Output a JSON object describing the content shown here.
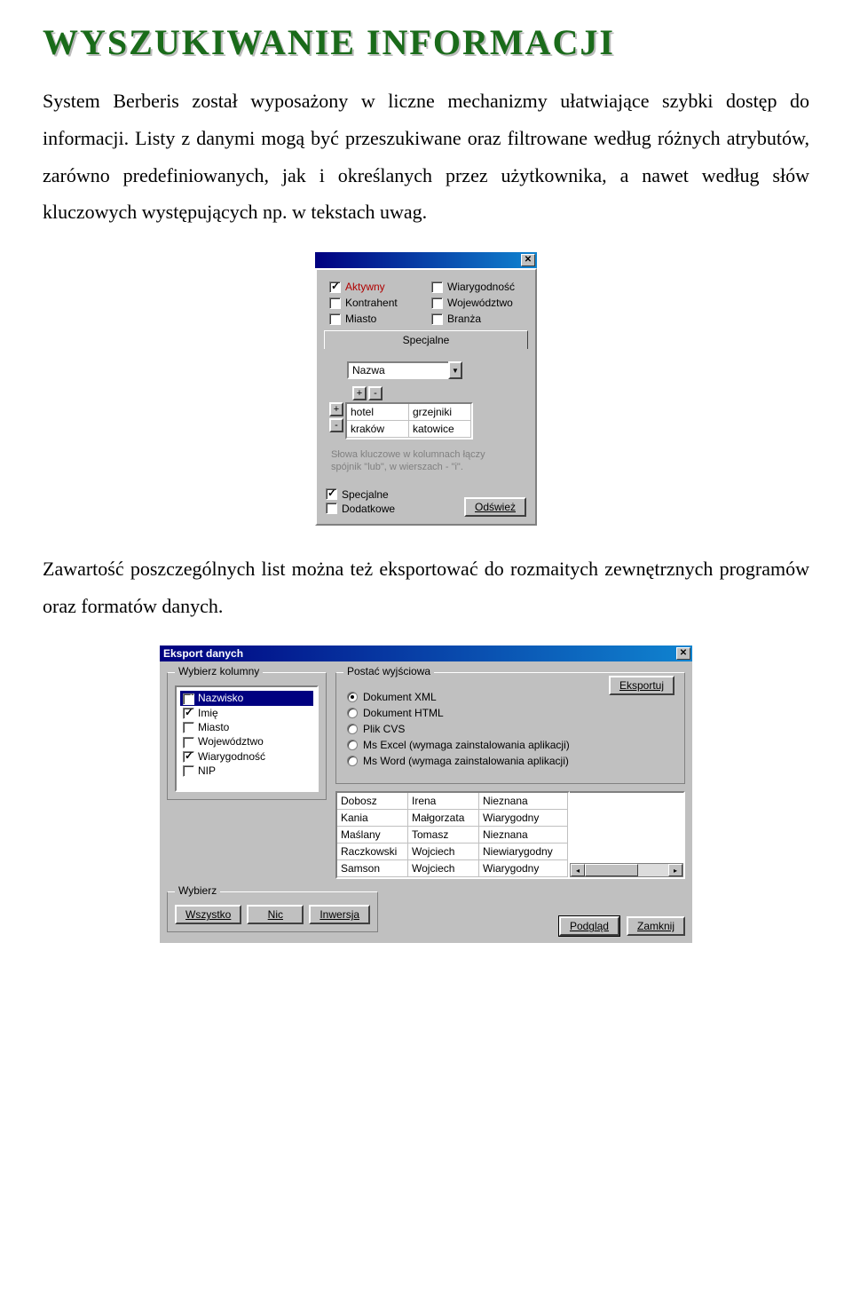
{
  "title": "WYSZUKIWANIE INFORMACJI",
  "para1": "System Berberis został wyposażony w liczne mechanizmy ułatwiające szybki dostęp do informacji. Listy z danymi mogą być przeszukiwane oraz filtrowane według różnych atrybutów, zarówno predefiniowanych, jak i określanych przez użytkownika, a nawet według słów kluczowych występujących np. w tekstach uwag.",
  "para2": "Zawartość poszczególnych list można też eksportować do rozmaitych zewnętrznych programów oraz formatów danych.",
  "dlg1": {
    "checks": [
      {
        "label": "Aktywny",
        "checked": true,
        "accent": "red"
      },
      {
        "label": "Wiarygodność",
        "checked": false
      },
      {
        "label": "Kontrahent",
        "checked": false
      },
      {
        "label": "Województwo",
        "checked": false
      },
      {
        "label": "Miasto",
        "checked": false
      },
      {
        "label": "Branża",
        "checked": false
      }
    ],
    "tab": "Specjalne",
    "dropdown": "Nazwa",
    "keywords": [
      [
        "hotel",
        "grzejniki"
      ],
      [
        "kraków",
        "katowice"
      ]
    ],
    "hint1": "Słowa kluczowe w kolumnach łączy",
    "hint2": "spójnik \"lub\", w wierszach - \"i\".",
    "bottom_checks": [
      {
        "label": "Specjalne",
        "checked": true
      },
      {
        "label": "Dodatkowe",
        "checked": false
      }
    ],
    "refresh": "Odśwież",
    "plus": "+",
    "minus": "-"
  },
  "dlg2": {
    "title": "Eksport danych",
    "group_cols": "Wybierz kolumny",
    "cols": [
      {
        "label": "Nazwisko",
        "checked": true,
        "selected": true
      },
      {
        "label": "Imię",
        "checked": true
      },
      {
        "label": "Miasto",
        "checked": false
      },
      {
        "label": "Województwo",
        "checked": false
      },
      {
        "label": "Wiarygodność",
        "checked": true
      },
      {
        "label": "NIP",
        "checked": false
      }
    ],
    "group_format": "Postać wyjściowa",
    "radios": [
      {
        "label": "Dokument XML",
        "on": true
      },
      {
        "label": "Dokument HTML",
        "on": false
      },
      {
        "label": "Plik CVS",
        "on": false
      },
      {
        "label": "Ms Excel (wymaga zainstalowania aplikacji)",
        "on": false
      },
      {
        "label": "Ms Word (wymaga zainstalowania aplikacji)",
        "on": false
      }
    ],
    "export": "Eksportuj",
    "preview_rows": [
      [
        "Dobosz",
        "Irena",
        "Nieznana"
      ],
      [
        "Kania",
        "Małgorzata",
        "Wiarygodny"
      ],
      [
        "Maślany",
        "Tomasz",
        "Nieznana"
      ],
      [
        "Raczkowski",
        "Wojciech",
        "Niewiarygodny"
      ],
      [
        "Samson",
        "Wojciech",
        "Wiarygodny"
      ]
    ],
    "group_select": "Wybierz",
    "btn_all": "Wszystko",
    "btn_none": "Nic",
    "btn_inv": "Inwersja",
    "btn_preview": "Podgląd",
    "btn_close": "Zamknij"
  }
}
